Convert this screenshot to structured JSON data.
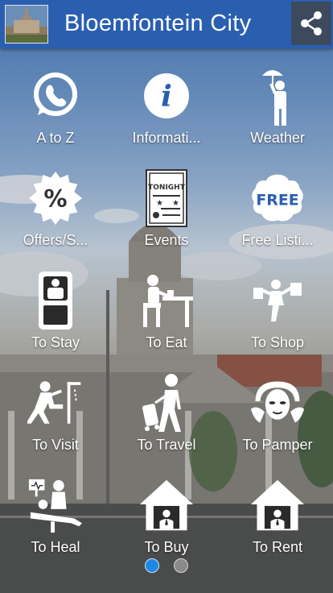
{
  "header": {
    "title": "Bloemfontein City"
  },
  "grid": [
    {
      "label": "A to Z",
      "icon": "whatsapp-icon"
    },
    {
      "label": "Informati...",
      "icon": "info-icon"
    },
    {
      "label": "Weather",
      "icon": "umbrella-person-icon"
    },
    {
      "label": "Offers/S...",
      "icon": "percent-badge-icon"
    },
    {
      "label": "Events",
      "icon": "events-tonight-icon"
    },
    {
      "label": "Free Listi...",
      "icon": "free-badge-icon"
    },
    {
      "label": "To Stay",
      "icon": "hotel-bed-icon"
    },
    {
      "label": "To Eat",
      "icon": "dining-icon"
    },
    {
      "label": "To Shop",
      "icon": "shopping-bags-icon"
    },
    {
      "label": "To Visit",
      "icon": "visit-icon"
    },
    {
      "label": "To Travel",
      "icon": "traveler-luggage-icon"
    },
    {
      "label": "To Pamper",
      "icon": "spa-face-icon"
    },
    {
      "label": "To Heal",
      "icon": "doctor-patient-icon"
    },
    {
      "label": "To Buy",
      "icon": "house-icon"
    },
    {
      "label": "To Rent",
      "icon": "house-icon"
    }
  ],
  "pager": {
    "pages": 2,
    "current": 1
  },
  "colors": {
    "appbar": "#2a5fb0",
    "share_bg": "#3d4a5e",
    "dot_active": "#1e88e5",
    "dot_inactive": "#8a8a8a"
  }
}
